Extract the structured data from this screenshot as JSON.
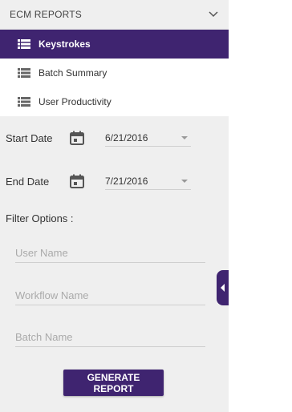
{
  "sidebar": {
    "section_title": "ECM REPORTS",
    "expand_icon": "chevron-down-icon",
    "reports": [
      {
        "label": "Keystrokes",
        "icon": "list-icon",
        "active": true
      },
      {
        "label": "Batch Summary",
        "icon": "list-icon",
        "active": false
      },
      {
        "label": "User Productivity",
        "icon": "list-icon",
        "active": false
      }
    ]
  },
  "filters": {
    "start_date": {
      "label": "Start Date",
      "value": "6/21/2016",
      "icon": "calendar-icon"
    },
    "end_date": {
      "label": "End Date",
      "value": "7/21/2016",
      "icon": "calendar-icon"
    },
    "options_heading": "Filter Options :",
    "user_name_placeholder": "User Name",
    "workflow_name_placeholder": "Workflow Name",
    "batch_name_placeholder": "Batch Name"
  },
  "actions": {
    "generate_label": "GENERATE REPORT"
  },
  "collapse_handle_icon": "chevron-left-icon",
  "colors": {
    "accent": "#3f2470",
    "panel_bg": "#efefef"
  }
}
